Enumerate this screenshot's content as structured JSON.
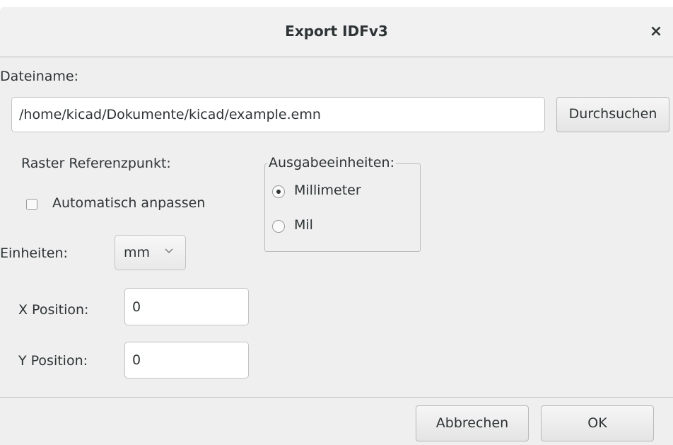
{
  "window": {
    "title": "Export IDFv3",
    "close_glyph": "×"
  },
  "file": {
    "label": "Dateiname:",
    "path": "/home/kicad/Dokumente/kicad/example.emn",
    "browse_label": "Durchsuchen"
  },
  "grid_reference": {
    "heading": "Raster Referenzpunkt:",
    "auto_adjust_label": "Automatisch anpassen",
    "auto_adjust_checked": false,
    "units_label": "Einheiten:",
    "units_value": "mm",
    "x_label": "X Position:",
    "x_value": "0",
    "y_label": "Y Position:",
    "y_value": "0"
  },
  "output_units": {
    "heading": "Ausgabeeinheiten:",
    "options": [
      {
        "label": "Millimeter",
        "selected": true
      },
      {
        "label": "Mil",
        "selected": false
      }
    ]
  },
  "footer": {
    "cancel_label": "Abbrechen",
    "ok_label": "OK"
  },
  "icons": {
    "close": "close-icon",
    "checkbox": "checkbox-icon",
    "radio": "radio-icon",
    "dropdown": "chevron-down-icon"
  }
}
